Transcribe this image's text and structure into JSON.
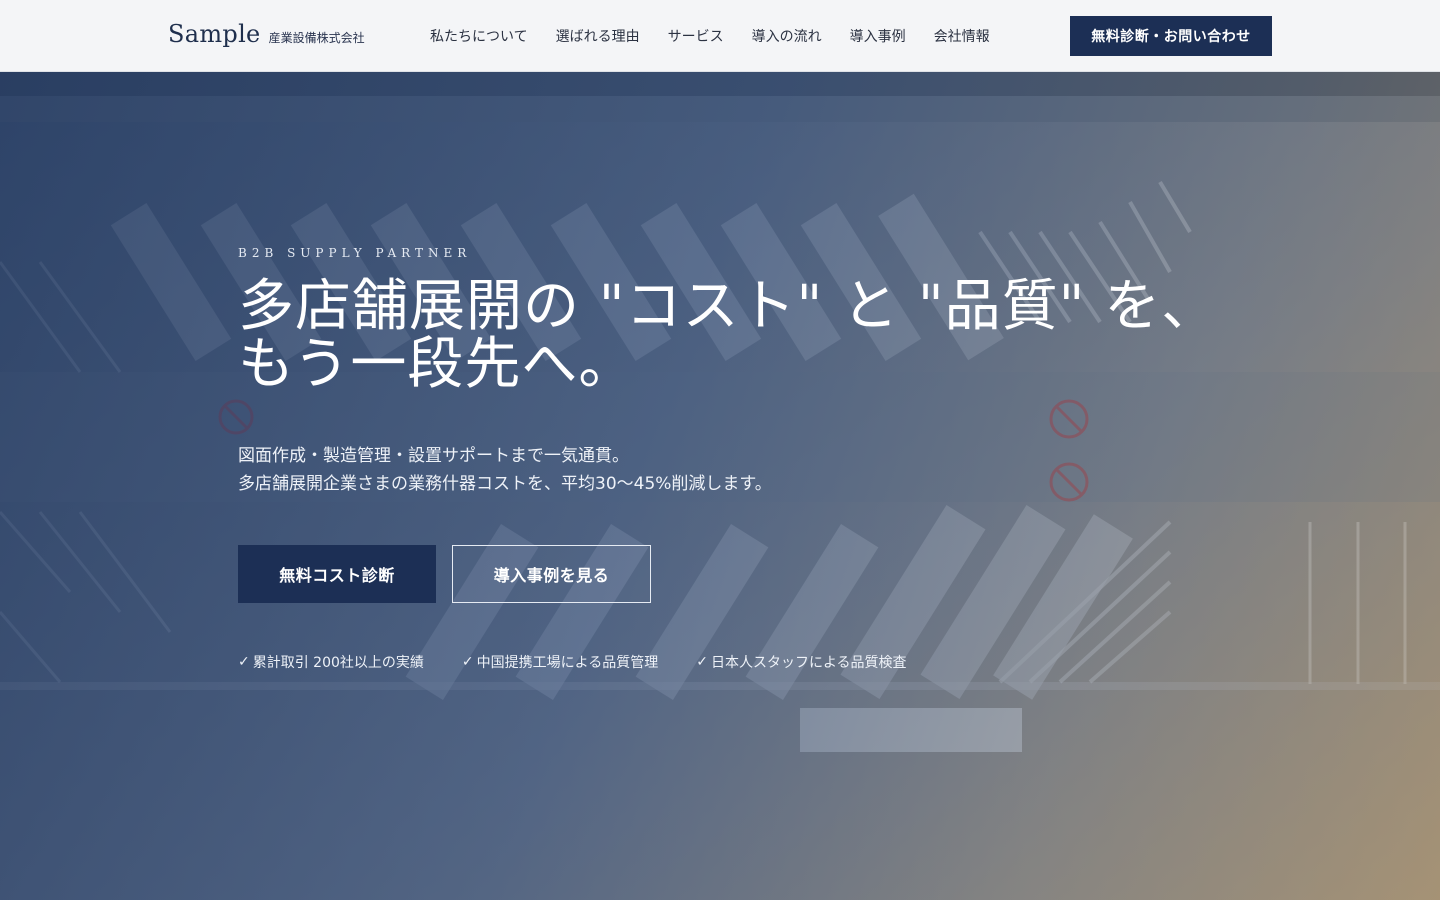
{
  "header": {
    "logo_main": "Sample",
    "logo_sub": "産業設備株式会社",
    "nav": [
      {
        "label": "私たちについて"
      },
      {
        "label": "選ばれる理由"
      },
      {
        "label": "サービス"
      },
      {
        "label": "導入の流れ"
      },
      {
        "label": "導入事例"
      },
      {
        "label": "会社情報"
      }
    ],
    "cta_label": "無料診断・お問い合わせ"
  },
  "hero": {
    "eyebrow": "B2B SUPPLY PARTNER",
    "headline_line1": "多店舗展開の \"コスト\" と \"品質\" を、",
    "headline_line2": "もう一段先へ。",
    "desc_line1": "図面作成・製造管理・設置サポートまで一気通貫。",
    "desc_line2": "多店舗展開企業さまの業務什器コストを、平均30〜45%削減します。",
    "primary_button": "無料コスト診断",
    "secondary_button": "導入事例を見る",
    "features": [
      {
        "check": "✓",
        "text": "累計取引 200社以上の実績"
      },
      {
        "check": "✓",
        "text": "中国提携工場による品質管理"
      },
      {
        "check": "✓",
        "text": "日本人スタッフによる品質検査"
      }
    ]
  },
  "colors": {
    "navy": "#1c2f55",
    "header_bg": "#f4f5f7"
  }
}
